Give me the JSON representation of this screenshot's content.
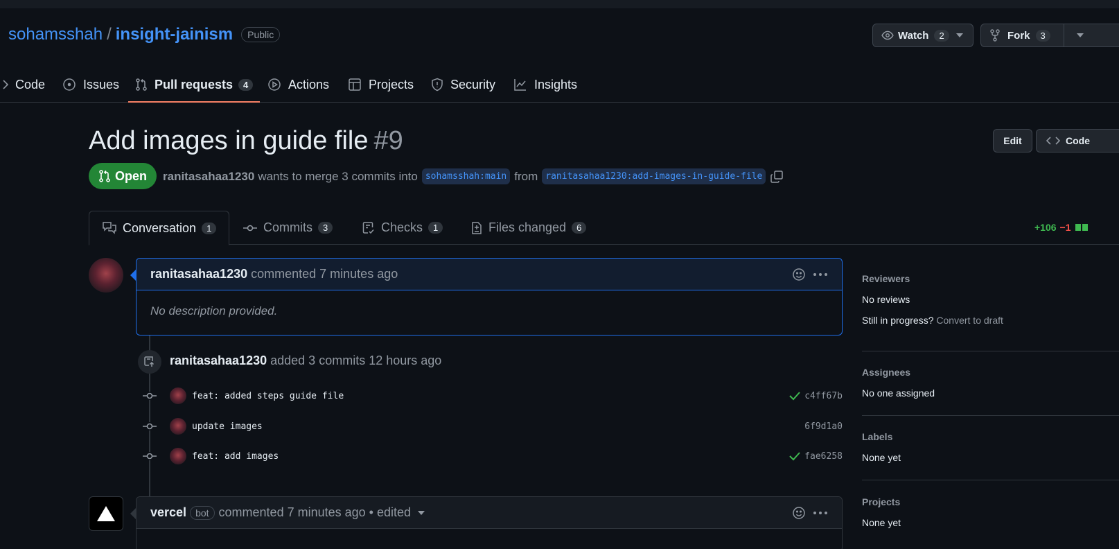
{
  "repo": {
    "owner": "sohamsshah",
    "separator": "/",
    "name": "insight-jainism",
    "visibility": "Public"
  },
  "header_actions": {
    "watch_label": "Watch",
    "watch_count": "2",
    "fork_label": "Fork",
    "fork_count": "3"
  },
  "nav": {
    "code": "Code",
    "issues": "Issues",
    "pull_requests": "Pull requests",
    "pull_requests_count": "4",
    "actions": "Actions",
    "projects": "Projects",
    "security": "Security",
    "insights": "Insights"
  },
  "pr": {
    "title": "Add images in guide file",
    "number": "#9",
    "state": "Open",
    "author": "ranitasahaa1230",
    "merge_text": "wants to merge 3 commits into",
    "base_branch": "sohamsshah:main",
    "from_text": "from",
    "head_branch": "ranitasahaa1230:add-images-in-guide-file",
    "edit_label": "Edit",
    "code_label": "Code"
  },
  "tabs": {
    "conversation": "Conversation",
    "conversation_count": "1",
    "commits": "Commits",
    "commits_count": "3",
    "checks": "Checks",
    "checks_count": "1",
    "files": "Files changed",
    "files_count": "6"
  },
  "diffstat": {
    "additions": "+106",
    "deletions": "−1"
  },
  "comment1": {
    "author": "ranitasahaa1230",
    "action": "commented 7 minutes ago",
    "body": "No description provided."
  },
  "event": {
    "author": "ranitasahaa1230",
    "text": "added 3 commits 12 hours ago"
  },
  "commits": [
    {
      "message": "feat: added steps guide file",
      "sha": "c4ff67b",
      "check": true
    },
    {
      "message": "update images",
      "sha": "6f9d1a0",
      "check": false
    },
    {
      "message": "feat: add images",
      "sha": "fae6258",
      "check": true
    }
  ],
  "comment2": {
    "author": "vercel",
    "badge": "bot",
    "action": "commented 7 minutes ago • edited"
  },
  "sidebar": {
    "reviewers_title": "Reviewers",
    "reviewers_value": "No reviews",
    "progress_text": "Still in progress?",
    "convert_link": "Convert to draft",
    "assignees_title": "Assignees",
    "assignees_value": "No one assigned",
    "labels_title": "Labels",
    "labels_value": "None yet",
    "projects_title": "Projects",
    "projects_value": "None yet"
  },
  "colors": {
    "accent_blue": "#4493f8",
    "open_green": "#238636",
    "nav_underline": "#f78166",
    "check_green": "#3fb950"
  }
}
